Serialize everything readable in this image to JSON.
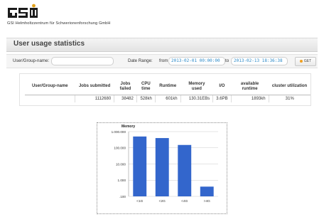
{
  "brand": {
    "logo_text": "GSI",
    "org_name": "GSI Helmholtzzentrum für Schwerionenforschung GmbH"
  },
  "page": {
    "title": "User usage statistics"
  },
  "form": {
    "user_label": "User/Group-name:",
    "user_value": "",
    "date_range_label": "Date Range:",
    "from_label": "from",
    "from_value": "2013-02-01 00:00:00",
    "to_label": "to",
    "to_value": "2013-02-13 18:36:38",
    "get_label": "GET"
  },
  "table": {
    "headers": [
      "User/Group-name",
      "Jobs submitted",
      "Jobs failed",
      "CPU time",
      "Runtime",
      "Memory used",
      "I/O",
      "available runtime",
      "cluster utilization"
    ],
    "rows": [
      [
        "",
        "1112680",
        "38482",
        "528kh",
        "601kh",
        "130.31EBs",
        "3.6PB",
        "1893kh",
        "31%"
      ]
    ]
  },
  "chart_data": {
    "type": "bar",
    "title": "Memory",
    "categories": [
      "<1G",
      "<2G",
      "<4G",
      ">4G"
    ],
    "values": [
      500000,
      400000,
      150000,
      400
    ],
    "ylabel": "",
    "xlabel": "",
    "yscale": "log",
    "ylim": [
      100,
      1000000
    ],
    "yticks": [
      100,
      1000,
      10000,
      100000,
      1000000
    ],
    "ytick_labels": [
      ".100",
      "1.000",
      "10.000",
      "100.000",
      "1.000.000"
    ],
    "grid": true,
    "bar_color": "#3366cc"
  },
  "colors": {
    "accent": "#2e8bc8",
    "bar": "#3366cc",
    "button_dot": "#f0a020"
  }
}
